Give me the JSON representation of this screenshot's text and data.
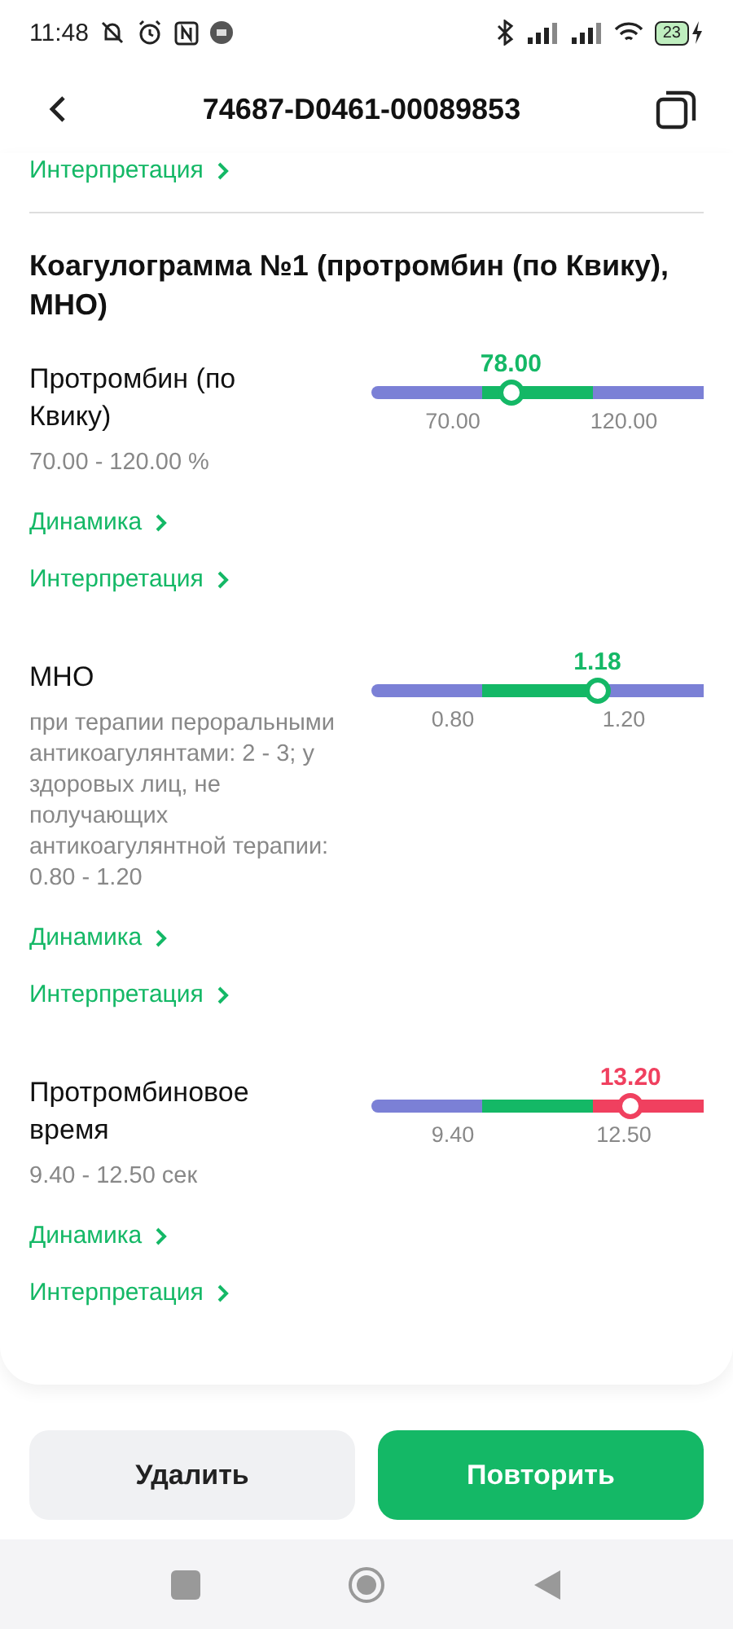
{
  "status_bar": {
    "time": "11:48",
    "battery": "23"
  },
  "header": {
    "title": "74687-D0461-00089853"
  },
  "top_link": "Интерпретация",
  "section": {
    "title": "Коагулограмма №1 (протромбин (по Квику), МНО)",
    "tests": [
      {
        "name": "Протромбин (по Квику)",
        "reference": "70.00 - 120.00 %",
        "value": "78.00",
        "low": "70.00",
        "high": "120.00",
        "level": 0.42,
        "out_of_range": false,
        "links": [
          "Динамика",
          "Интерпретация"
        ]
      },
      {
        "name": "МНО",
        "reference": "при терапии пероральными антикоагулянтами: 2 - 3; у здоровых лиц, не получающих антикоагулянтной терапии: 0.80 - 1.20",
        "value": "1.18",
        "low": "0.80",
        "high": "1.20",
        "level": 0.68,
        "out_of_range": false,
        "links": [
          "Динамика",
          "Интерпретация"
        ]
      },
      {
        "name": "Протромбиновое время",
        "reference": "9.40 - 12.50 сек",
        "value": "13.20",
        "low": "9.40",
        "high": "12.50",
        "level": 0.78,
        "out_of_range": true,
        "links": [
          "Динамика",
          "Интерпретация"
        ]
      }
    ]
  },
  "buttons": [
    {
      "label": "Удалить",
      "kind": "secondary"
    },
    {
      "label": "Повторить",
      "kind": "primary"
    }
  ]
}
